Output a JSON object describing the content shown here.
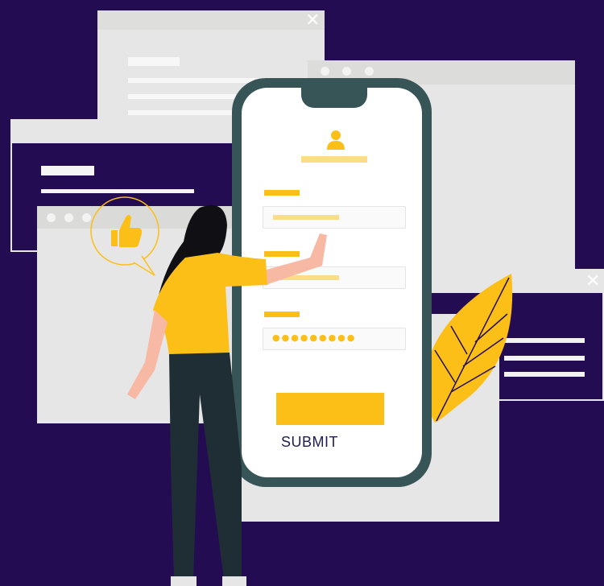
{
  "form": {
    "submit_label": "SUBMIT",
    "password_mask": "●●●●●●●●●",
    "submit_color": "#fbbf18"
  },
  "icons": {
    "close": "close-icon",
    "like": "thumbs-up-icon",
    "user": "user-icon"
  },
  "colors": {
    "background": "#230c52",
    "accent": "#fbbf18",
    "phone_frame": "#375457",
    "window": "#e7e6e6"
  }
}
